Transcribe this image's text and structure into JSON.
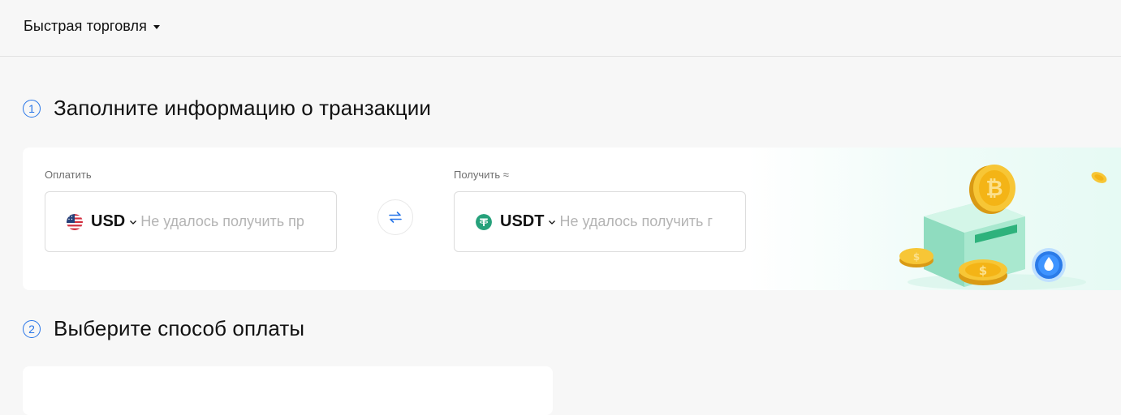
{
  "topbar": {
    "menu_label": "Быстрая торговля"
  },
  "steps": [
    {
      "number": "1",
      "title": "Заполните информацию о транзакции"
    },
    {
      "number": "2",
      "title": "Выберите способ оплаты"
    }
  ],
  "pay": {
    "label": "Оплатить",
    "currency": "USD",
    "currency_icon": "us-flag-icon",
    "placeholder": "Не удалось получить пр"
  },
  "receive": {
    "label": "Получить ≈",
    "currency": "USDT",
    "currency_icon": "tether-icon",
    "placeholder": "Не удалось получить г"
  },
  "colors": {
    "accent": "#2775e8",
    "tether": "#26a17b",
    "page_background": "#f7f7f7"
  }
}
